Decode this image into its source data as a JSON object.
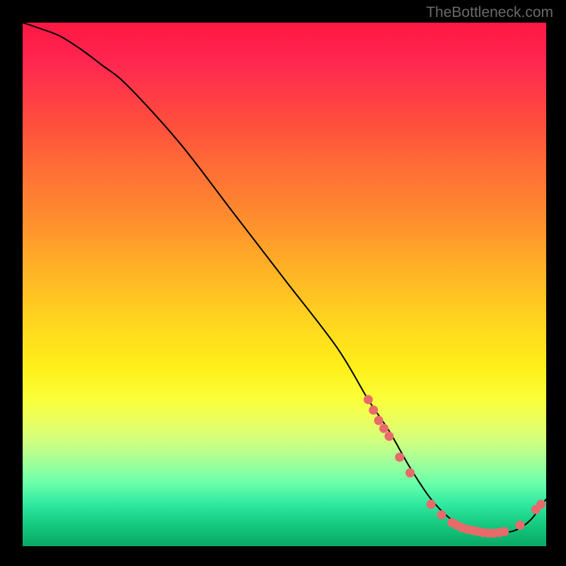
{
  "watermark": "TheBottleneck.com",
  "chart_data": {
    "type": "line",
    "title": "",
    "xlabel": "",
    "ylabel": "",
    "xlim": [
      0,
      100
    ],
    "ylim": [
      0,
      100
    ],
    "grid": false,
    "legend": false,
    "background": "rainbow-gradient-red-to-green",
    "series": [
      {
        "name": "bottleneck-curve",
        "style": "black-line",
        "x": [
          0,
          3,
          7,
          11,
          15,
          20,
          30,
          40,
          50,
          60,
          66,
          70,
          74,
          78,
          82,
          86,
          90,
          94,
          97,
          100
        ],
        "y": [
          100,
          99,
          97.5,
          95,
          92,
          88,
          77,
          64,
          51,
          38,
          28,
          22,
          15,
          9,
          5,
          3,
          2.5,
          3,
          5,
          9
        ]
      }
    ],
    "markers": [
      {
        "name": "data-points-on-curve",
        "style": "salmon-dots",
        "points": [
          {
            "x": 66,
            "y": 28
          },
          {
            "x": 67,
            "y": 26
          },
          {
            "x": 68,
            "y": 24
          },
          {
            "x": 69,
            "y": 22.5
          },
          {
            "x": 70,
            "y": 21
          },
          {
            "x": 72,
            "y": 17
          },
          {
            "x": 74,
            "y": 14
          },
          {
            "x": 78,
            "y": 8
          },
          {
            "x": 80,
            "y": 6
          },
          {
            "x": 82,
            "y": 4.5
          },
          {
            "x": 83,
            "y": 4
          },
          {
            "x": 84,
            "y": 3.5
          },
          {
            "x": 85,
            "y": 3.2
          },
          {
            "x": 86,
            "y": 3
          },
          {
            "x": 87,
            "y": 2.8
          },
          {
            "x": 88,
            "y": 2.6
          },
          {
            "x": 89,
            "y": 2.5
          },
          {
            "x": 90,
            "y": 2.5
          },
          {
            "x": 91,
            "y": 2.6
          },
          {
            "x": 92,
            "y": 2.8
          },
          {
            "x": 95,
            "y": 4
          },
          {
            "x": 98,
            "y": 7
          },
          {
            "x": 99,
            "y": 8
          }
        ]
      }
    ]
  }
}
